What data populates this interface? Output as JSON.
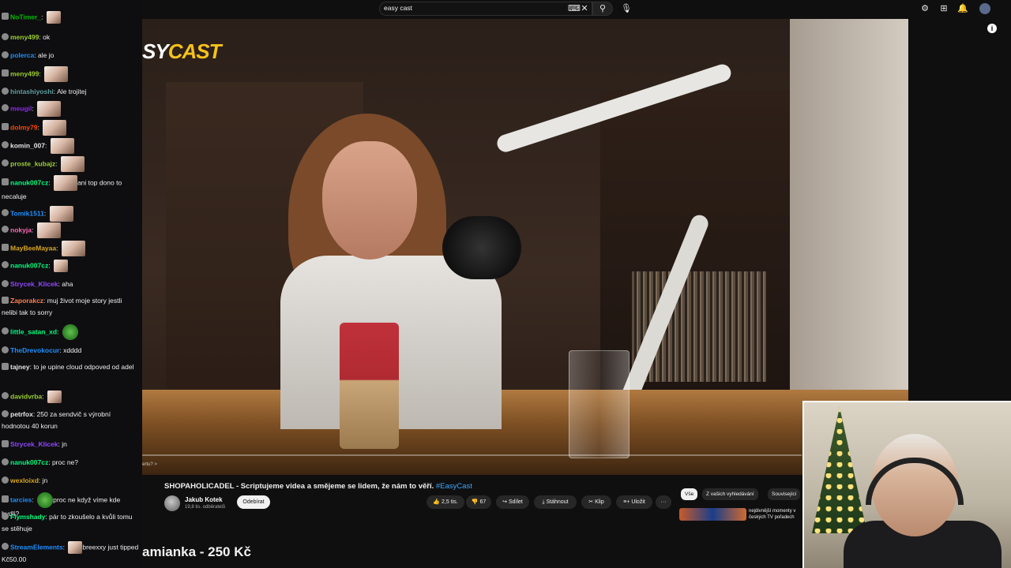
{
  "chat": {
    "messages": [
      {
        "user": "NoTimer_",
        "text": "",
        "color": "#00c000",
        "emote": "small"
      },
      {
        "user": "meny499",
        "text": "ok",
        "color": "#9acd32"
      },
      {
        "user": "polerca",
        "text": "ale jo",
        "color": "#1e90ff"
      },
      {
        "user": "meny499",
        "text": "",
        "color": "#9acd32",
        "emote": "face"
      },
      {
        "user": "hintashiyoshi",
        "text": "Ale trojitej",
        "color": "#5f9ea0"
      },
      {
        "user": "meugil",
        "text": "",
        "color": "#8a2be2",
        "emote": "face"
      },
      {
        "user": "dolmy79",
        "text": "",
        "color": "#ff4500",
        "emote": "face"
      },
      {
        "user": "komin_007",
        "text": "",
        "color": "#e6e6e6",
        "emote": "face"
      },
      {
        "user": "proste_kubajz",
        "text": "",
        "color": "#9acd32",
        "emote": "face"
      },
      {
        "user": "nanuk007cz",
        "text": "ani top dono to necaluje",
        "color": "#00ff7f",
        "emote": "face"
      },
      {
        "user": "Tomik1511",
        "text": "",
        "color": "#1e90ff",
        "emote": "face"
      },
      {
        "user": "nokyja",
        "text": "",
        "color": "#ff69b4",
        "emote": "face"
      },
      {
        "user": "MayBeeMayaa",
        "text": "",
        "color": "#daa520",
        "emote": "face"
      },
      {
        "user": "nanuk007cz",
        "text": "",
        "color": "#00ff7f",
        "emote": "small"
      },
      {
        "user": "Strycek_Klicek",
        "text": "aha",
        "color": "#9146ff"
      },
      {
        "user": "Zaporakcz",
        "text": "muj život moje story jestli nelibi tak to sorry",
        "color": "#ff7f50"
      },
      {
        "user": "little_satan_xd",
        "text": "",
        "color": "#00ff7f",
        "emote": "frog"
      },
      {
        "user": "TheDrevokocur",
        "text": "xdddd",
        "color": "#1e90ff"
      },
      {
        "user": "tajney",
        "text": "to je upine cloud odpoved od adel",
        "color": "#e6e6e6"
      },
      {
        "user": "davidvrba",
        "text": "",
        "color": "#9acd32",
        "emote": "small"
      },
      {
        "user": "petrfox",
        "text": "250 za sendvič s výrobní hodnotou 40 korun",
        "color": "#e6e6e6"
      },
      {
        "user": "Strycek_Klicek",
        "text": "jn",
        "color": "#9146ff"
      },
      {
        "user": "nanuk007cz",
        "text": "proc ne?",
        "color": "#00ff7f"
      },
      {
        "user": "wexloixd",
        "text": "jn",
        "color": "#daa520"
      },
      {
        "user": "tarcies",
        "text": "proc ne když víme kde bydli?",
        "color": "#1e90ff",
        "emote": "frog"
      },
      {
        "user": "Flymshady",
        "text": "pár to zkoušelo a kvůli tomu se stěhuje",
        "color": "#00ff7f"
      },
      {
        "user": "StreamElements",
        "text": "breexxy just tipped Kč50.00",
        "color": "#1e90ff",
        "emote": "small"
      }
    ]
  },
  "topbar": {
    "search_value": "easy cast",
    "icons": [
      "keyboard-icon",
      "clear-icon",
      "search-icon",
      "mic-icon",
      "cast-icon",
      "create-icon",
      "bell-icon",
      "avatar"
    ]
  },
  "video": {
    "logo_part1": "SY",
    "logo_part2": "CAST",
    "prev_label": "ertu? >",
    "title": "SHOPAHOLICADEL - Scriptujeme videa a smějeme se lidem, že nám to věří.",
    "hashtag": "#EasyCast",
    "channel_name": "Jakub Kotek",
    "channel_subs": "19,8 tis. odběratelů",
    "subscribe_label": "Odebírat",
    "like_count": "2,5 tis.",
    "dislike_count": "67",
    "share_label": "Sdílet",
    "download_label": "Stáhnout",
    "clip_label": "Klip",
    "save_label": "Uložit",
    "more_label": "···",
    "chips": [
      "Vše",
      "Z vašich vyhledávání",
      "Související"
    ],
    "rec_text": "nejdivnější momenty v českých TV pořadech",
    "lower_banner": "amianka - 250 Kč"
  },
  "colors": {
    "accent_yellow": "#f6c21a",
    "link_blue": "#3ea6ff",
    "notification_red": "#ff0000"
  }
}
